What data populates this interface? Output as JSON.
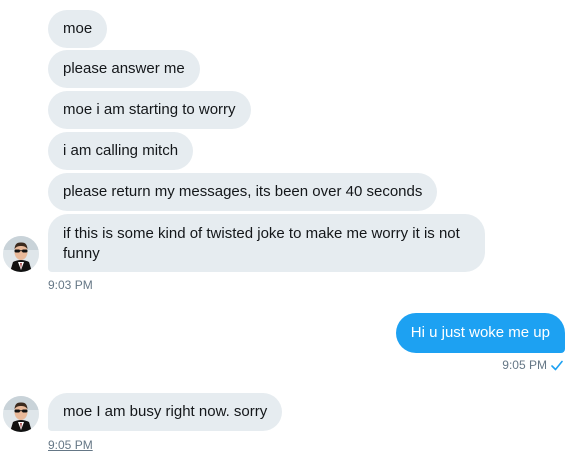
{
  "conversation": {
    "group1": {
      "messages": [
        "moe",
        "please answer me",
        "moe i am starting to worry",
        "i am calling mitch",
        "please return my messages, its been over 40 seconds",
        "if this is some kind of twisted joke to make me worry it is not funny"
      ],
      "time": "9:03 PM"
    },
    "outgoing": {
      "message": "Hi u just woke me up",
      "time": "9:05 PM",
      "status_icon": "checkmark-icon"
    },
    "group2": {
      "message": "moe I am busy right now. sorry",
      "time": "9:05 PM"
    }
  },
  "colors": {
    "incoming_bubble": "#e6ecf0",
    "outgoing_bubble": "#1da1f2",
    "timestamp": "#657786"
  },
  "icons": {
    "avatar": "user-avatar-sunglasses"
  }
}
